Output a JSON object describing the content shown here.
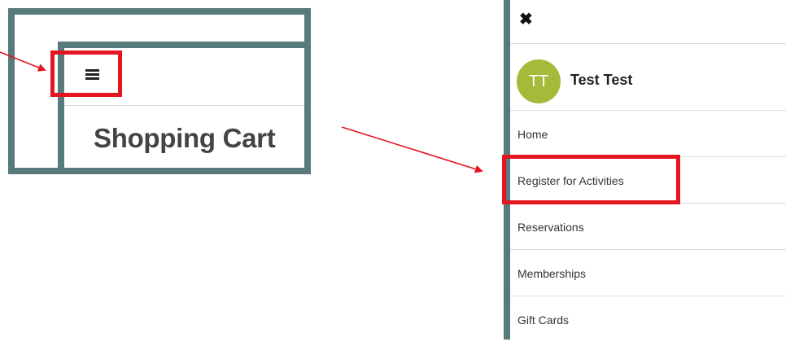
{
  "left_screen": {
    "menu_icon": "hamburger-icon",
    "page_title": "Shopping Cart"
  },
  "menu": {
    "close_icon": "close-icon",
    "user": {
      "initials": "TT",
      "name": "Test Test",
      "avatar_color": "#a6b93a"
    },
    "items": [
      {
        "label": "Home"
      },
      {
        "label": "Register for Activities"
      },
      {
        "label": "Reservations"
      },
      {
        "label": "Memberships"
      },
      {
        "label": "Gift Cards"
      }
    ]
  },
  "colors": {
    "frame": "#587a7a",
    "highlight": "#e4151f",
    "arrow": "#e4151f"
  }
}
